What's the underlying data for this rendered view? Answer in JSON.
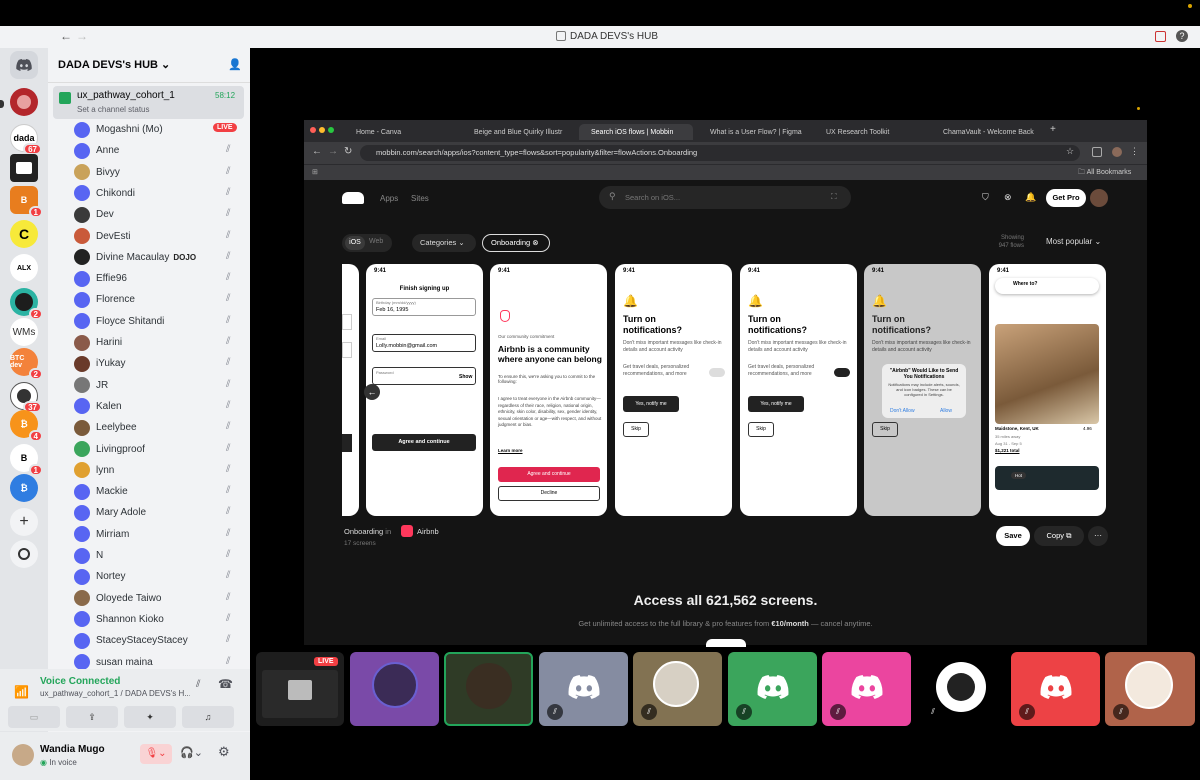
{
  "window": {
    "title": "DADA DEVS's HUB"
  },
  "server": {
    "name": "DADA DEVS's HUB"
  },
  "guild_badges": {
    "g2": "67",
    "g4": "1",
    "g7": "2",
    "g8": "WMs",
    "g9": "2",
    "g10": "37",
    "g11": "4",
    "g12": "1",
    "g9_label": "BTC dev"
  },
  "channel": {
    "name": "ux_pathway_cohort_1",
    "time": "58:12",
    "status": "Set a channel status"
  },
  "members": [
    {
      "name": "Mogashni (Mo)",
      "live": "LIVE"
    },
    {
      "name": "Anne"
    },
    {
      "name": "Bivyy"
    },
    {
      "name": "Chikondi"
    },
    {
      "name": "Dev"
    },
    {
      "name": "DevEsti"
    },
    {
      "name": "Divine Macaulay",
      "tag": "DOJO"
    },
    {
      "name": "Effie96"
    },
    {
      "name": "Florence"
    },
    {
      "name": "Floyce Shitandi"
    },
    {
      "name": "Harini"
    },
    {
      "name": "iYukay"
    },
    {
      "name": "JR"
    },
    {
      "name": "Kalen"
    },
    {
      "name": "Leelybee"
    },
    {
      "name": "Livingproof"
    },
    {
      "name": "lynn"
    },
    {
      "name": "Mackie"
    },
    {
      "name": "Mary Adole"
    },
    {
      "name": "Mirriam"
    },
    {
      "name": "N"
    },
    {
      "name": "Nortey"
    },
    {
      "name": "Oloyede Taiwo"
    },
    {
      "name": "Shannon Kioko"
    },
    {
      "name": "StaceyStaceyStacey"
    },
    {
      "name": "susan maina"
    }
  ],
  "voice": {
    "title": "Voice Connected",
    "sub": "ux_pathway_cohort_1 / DADA DEVS's H..."
  },
  "user": {
    "name": "Wandia Mugo",
    "status": "In voice"
  },
  "browser": {
    "tabs": [
      "Home - Canva",
      "Beige and Blue Quirky Illustr",
      "Search iOS flows | Mobbin",
      "What is a User Flow? | Figma",
      "UX Research Toolkit",
      "ChamaVault - Welcome Back"
    ],
    "url": "mobbin.com/search/apps/ios?content_type=flows&sort=popularity&filter=flowActions.Onboarding",
    "bookmarks": "All Bookmarks"
  },
  "mobbin": {
    "nav_apps": "Apps",
    "nav_sites": "Sites",
    "search_placeholder": "Search on iOS...",
    "get_pro": "Get Pro",
    "seg_ios": "iOS",
    "seg_web": "Web",
    "categories": "Categories",
    "filter": "Onboarding",
    "showing": "Showing",
    "flows": "947 flows",
    "sort": "Most popular",
    "flow_title": "Onboarding",
    "flow_in": "in",
    "flow_app": "Airbnb",
    "flow_count": "17 screens",
    "save": "Save",
    "copy": "Copy",
    "cta_title": "Access all 621,562 screens.",
    "cta_pre": "Get unlimited access to the full library & pro features from ",
    "cta_price": "€10/month",
    "cta_post": " — cancel anytime."
  },
  "screens": {
    "time": "9:41",
    "s2_header": "Finish signing up",
    "s2_field1": "Birthday (mm/dd/yyyy)",
    "s2_field1_val": "Feb 16, 1995",
    "s2_email_label": "Email",
    "s2_email": "Lolly.mobbin@gmail.com",
    "s2_pw": "Password",
    "s2_show": "Show",
    "s2_btn": "Agree and continue",
    "s3_sub": "Our community commitment",
    "s3_title": "Airbnb is a community where anyone can belong",
    "s3_body": "To ensure this, we're asking you to commit to the following:",
    "s3_commit": "I agree to treat everyone in the Airbnb community—regardless of their race, religion, national origin, ethnicity, skin color, disability, sex, gender identity, sexual orientation or age—with respect, and without judgment or bias.",
    "s3_learn": "Learn more",
    "s3_agree": "Agree and continue",
    "s3_decline": "Decline",
    "notif_title": "Turn on notifications?",
    "notif_body": "Don't miss important messages like check-in details and account activity",
    "notif_toggle": "Get travel deals, personalized recommendations, and more",
    "notif_yes": "Yes, notify me",
    "notif_skip": "Skip",
    "alert_title": "\"Airbnb\" Would Like to Send You Notifications",
    "alert_body": "Notifications may include alerts, sounds, and icon badges. These can be configured in Settings.",
    "alert_deny": "Don't Allow",
    "alert_allow": "Allow",
    "s7_where": "Where to?",
    "s7_loc": "Maidstone, Kent, UK",
    "s7_rating": "4.96",
    "s7_dist": "35 miles away",
    "s7_dates": "Aug 31 - Sep 5",
    "s7_price": "$1,221 total",
    "s7_tag": "Hot"
  },
  "tiles": {
    "live": "LIVE"
  }
}
